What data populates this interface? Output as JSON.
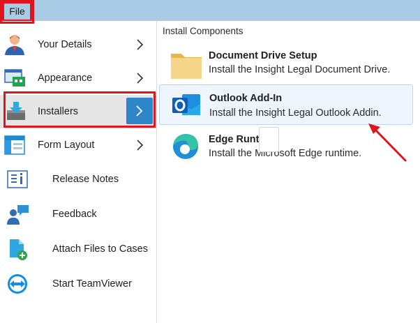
{
  "menubar": {
    "file_label": "File"
  },
  "menu": {
    "items": [
      {
        "label": "Your Details",
        "icon": "user-icon",
        "has_chevron": true
      },
      {
        "label": "Appearance",
        "icon": "appearance-icon",
        "has_chevron": true
      },
      {
        "label": "Installers",
        "icon": "installer-download-icon",
        "has_chevron": true,
        "selected": true
      },
      {
        "label": "Form Layout",
        "icon": "form-layout-icon",
        "has_chevron": true
      },
      {
        "label": "Release Notes",
        "icon": "release-notes-icon",
        "has_chevron": false
      },
      {
        "label": "Feedback",
        "icon": "feedback-icon",
        "has_chevron": false
      },
      {
        "label": "Attach Files to Cases",
        "icon": "attach-file-icon",
        "has_chevron": false
      },
      {
        "label": "Start TeamViewer",
        "icon": "teamviewer-icon",
        "has_chevron": false
      }
    ]
  },
  "panel": {
    "title": "Install Components",
    "components": [
      {
        "title": "Document Drive Setup",
        "description": "Install the Insight Legal Document Drive.",
        "icon": "folder-icon"
      },
      {
        "title": "Outlook Add-In",
        "description": "Install the Insight Legal Outlook Addin.",
        "icon": "outlook-icon",
        "highlighted": true
      },
      {
        "title": "Edge Runti",
        "description": "Install the Microsoft Edge runtime.",
        "icon": "edge-icon"
      }
    ]
  },
  "colors": {
    "menubar": "#a9cbe6",
    "highlight_box": "#e0141c",
    "chevron_button": "#2e86c8",
    "annotation_arrow": "#e0141c"
  }
}
